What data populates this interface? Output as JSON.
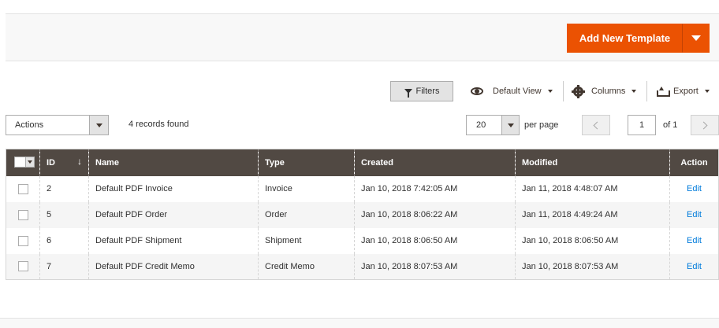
{
  "page_actions": {
    "add_button_label": "Add New Template",
    "accent_color": "#eb5202"
  },
  "toolbar": {
    "filters_label": "Filters",
    "view_label": "Default View",
    "columns_label": "Columns",
    "export_label": "Export",
    "icons": [
      "filter-icon",
      "eye-icon",
      "gear-icon",
      "export-icon"
    ]
  },
  "mass_actions": {
    "actions_label": "Actions",
    "records_found": "4 records found"
  },
  "pagination": {
    "per_page_value": "20",
    "per_page_label": "per page",
    "current_page": "1",
    "of_label": "of 1"
  },
  "grid": {
    "header_color": "#514943",
    "columns": [
      "ID",
      "Name",
      "Type",
      "Created",
      "Modified",
      "Action"
    ],
    "sort_indicator": "↓",
    "rows": [
      {
        "id": "2",
        "name": "Default PDF Invoice",
        "type": "Invoice",
        "created": "Jan 10, 2018 7:42:05 AM",
        "modified": "Jan 11, 2018 4:48:07 AM",
        "action": "Edit"
      },
      {
        "id": "5",
        "name": "Default PDF Order",
        "type": "Order",
        "created": "Jan 10, 2018 8:06:22 AM",
        "modified": "Jan 11, 2018 4:49:24 AM",
        "action": "Edit"
      },
      {
        "id": "6",
        "name": "Default PDF Shipment",
        "type": "Shipment",
        "created": "Jan 10, 2018 8:06:50 AM",
        "modified": "Jan 10, 2018 8:06:50 AM",
        "action": "Edit"
      },
      {
        "id": "7",
        "name": "Default PDF Credit Memo",
        "type": "Credit Memo",
        "created": "Jan 10, 2018 8:07:53 AM",
        "modified": "Jan 10, 2018 8:07:53 AM",
        "action": "Edit"
      }
    ]
  }
}
